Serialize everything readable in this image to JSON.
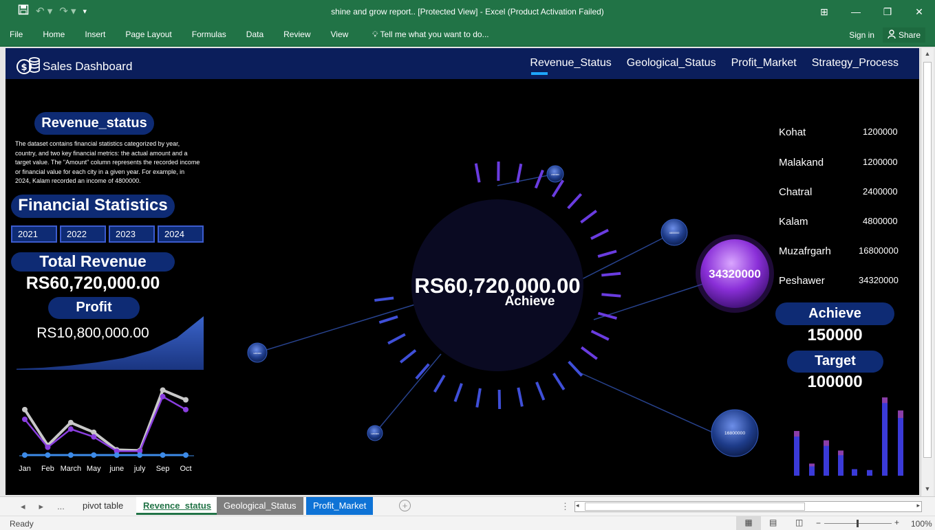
{
  "window": {
    "title": "shine and grow report..  [Protected View] - Excel (Product Activation Failed)",
    "controls": [
      "ribbon-display",
      "minimize",
      "restore",
      "close"
    ]
  },
  "ribbon": {
    "tabs": [
      "File",
      "Home",
      "Insert",
      "Page Layout",
      "Formulas",
      "Data",
      "Review",
      "View"
    ],
    "tell_me": "Tell me what you want to do...",
    "sign_in": "Sign in",
    "share": "Share"
  },
  "dashboard": {
    "brand": "Sales Dashboard",
    "nav": [
      "Revenue_Status",
      "Geological_Status",
      "Profit_Market",
      "Strategy_Process"
    ],
    "active_nav": "Revenue_Status",
    "section_title": "Revenue_status",
    "description": "The dataset contains financial statistics categorized by year, country, and two key financial metrics: the actual amount and a target value. The \"Amount\" column represents the recorded income or financial value for each city in a given year. For example, in 2024, Kalam recorded an income of 4800000.",
    "financial_title": "Financial Statistics",
    "years": [
      "2021",
      "2022",
      "2023",
      "2024"
    ],
    "total_revenue_label": "Total Revenue",
    "total_revenue_value": "RS60,720,000.00",
    "profit_label": "Profit",
    "profit_value": "RS10,800,000.00",
    "center_value": "RS60,720,000.00",
    "center_label": "Achieve",
    "big_bubble_value": "34320000",
    "small_bubbles": [
      "2400000",
      "4800000",
      "1200000",
      "1200000",
      "16800000"
    ],
    "cities": [
      {
        "name": "Kohat",
        "value": "1200000"
      },
      {
        "name": "Malakand",
        "value": "1200000"
      },
      {
        "name": "Chatral",
        "value": "2400000"
      },
      {
        "name": "Kalam",
        "value": "4800000"
      },
      {
        "name": "Muzafrgarh",
        "value": "16800000"
      },
      {
        "name": "Peshawer",
        "value": "34320000"
      }
    ],
    "achieve_label": "Achieve",
    "achieve_value": "150000",
    "target_label": "Target",
    "target_value": "100000",
    "colors": {
      "navy": "#0b1e5b",
      "pill": "#0e2b74",
      "purple": "#8a3ee0",
      "accent": "#1ea7ff"
    }
  },
  "chart_data": [
    {
      "type": "area",
      "title": "",
      "x": [
        1,
        2,
        3,
        4,
        5,
        6,
        7,
        8
      ],
      "values": [
        0.2,
        0.4,
        0.8,
        1.4,
        2.2,
        3.6,
        6,
        10
      ],
      "grid": false
    },
    {
      "type": "line",
      "categories": [
        "Jan",
        "Feb",
        "March",
        "May",
        "june",
        "july",
        "Sep",
        "Oct"
      ],
      "series": [
        {
          "values": [
            7,
            1.5,
            5,
            3.5,
            0.8,
            0.7,
            10,
            8.5
          ]
        },
        {
          "values": [
            5.5,
            1.2,
            4,
            2.8,
            0.6,
            0.6,
            9,
            7
          ]
        },
        {
          "values": [
            0,
            0,
            0,
            0,
            0,
            0,
            0,
            0
          ]
        }
      ],
      "ylim": [
        0,
        11
      ],
      "grid": false
    },
    {
      "type": "bar",
      "categories": [
        "1",
        "2",
        "3",
        "4",
        "5",
        "6",
        "7",
        "8"
      ],
      "series": [
        {
          "values": [
            4.2,
            1.0,
            3.2,
            2.2,
            0.7,
            0.6,
            7.8,
            6.2
          ]
        },
        {
          "values": [
            4.8,
            1.3,
            3.8,
            2.7,
            0.7,
            0.6,
            8.4,
            7.0
          ]
        }
      ],
      "ylim": [
        0,
        9
      ],
      "grid": false
    }
  ],
  "sheet_tabs": {
    "tabs": [
      "pivot table",
      "Revence_status",
      "Geological_Status",
      "Profit_Market"
    ],
    "active": "Revence_status",
    "ellipsis": "..."
  },
  "status_bar": {
    "ready": "Ready",
    "zoom": "100%"
  }
}
